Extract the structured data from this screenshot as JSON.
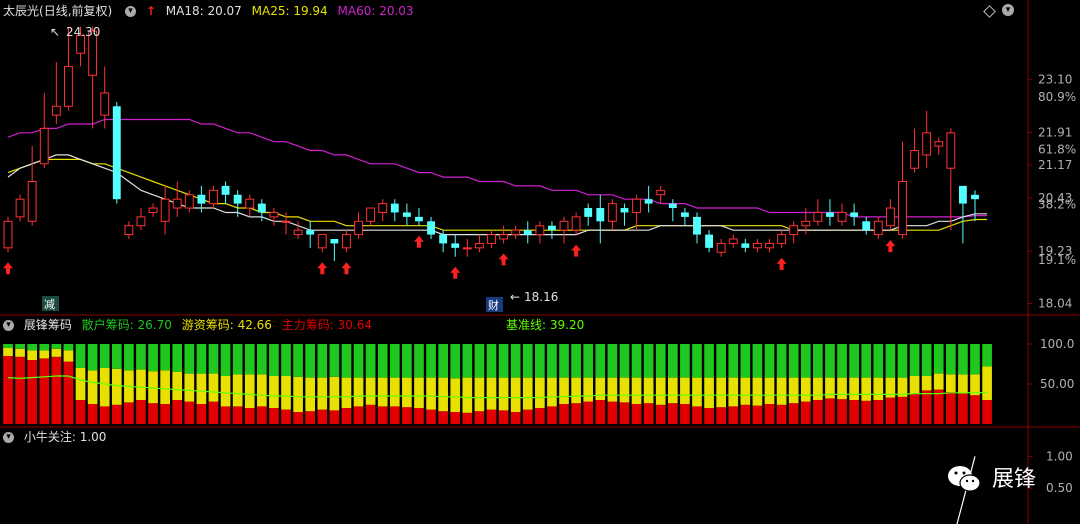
{
  "main_header": {
    "stock_name": "太辰光",
    "period": "(日线,前复权)",
    "ma18_label": "MA18: 20.07",
    "ma25_label": "MA25: 19.94",
    "ma60_label": "MA60: 20.03",
    "colors": {
      "ma18": "#e0e0e0",
      "ma25": "#e8e000",
      "ma60": "#d020d0"
    }
  },
  "chip_header": {
    "indicator_name": "展锋筹码",
    "retail_label": "散户筹码: 26.70",
    "hot_money_label": "游资筹码: 42.66",
    "main_force_label": "主力筹码: 30.64",
    "baseline_label": "基准线: 39.20",
    "colors": {
      "retail": "#1ec81e",
      "hot_money": "#e8e000",
      "main_force": "#e00000",
      "baseline": "#60ff00"
    }
  },
  "bull_header": {
    "indicator_name": "小牛关注",
    "value_label": ": 1.00"
  },
  "annotations": {
    "high_label": "24.30",
    "low_label": "18.16",
    "event_label_1": "减",
    "event_label_2": "财"
  },
  "watermark": {
    "text": "展锋"
  },
  "chart_data": {
    "type": "candlestick",
    "price_axis": {
      "ticks": [
        "23.10",
        "21.91",
        "21.17",
        "20.43",
        "19.23",
        "18.04"
      ],
      "tick_values": [
        23.1,
        21.91,
        21.17,
        20.43,
        19.23,
        18.04
      ],
      "pct_ticks": [
        "80.9%",
        "61.8%",
        "38.2%",
        "19.1%"
      ],
      "pct_tick_values": [
        22.71,
        21.52,
        20.28,
        19.03
      ],
      "ylim": [
        17.85,
        24.45
      ]
    },
    "candles": [
      [
        19.3,
        19.9,
        20.0,
        19.2
      ],
      [
        20.0,
        20.4,
        20.5,
        19.9
      ],
      [
        19.9,
        20.8,
        21.6,
        19.8
      ],
      [
        21.2,
        22.0,
        22.8,
        21.1
      ],
      [
        22.3,
        22.5,
        23.5,
        22.1
      ],
      [
        22.5,
        23.4,
        24.3,
        22.4
      ],
      [
        23.7,
        24.1,
        24.3,
        23.4
      ],
      [
        23.2,
        24.2,
        24.3,
        22.0
      ],
      [
        22.3,
        22.8,
        23.4,
        22.0
      ],
      [
        22.5,
        20.4,
        22.6,
        20.3
      ],
      [
        19.6,
        19.8,
        19.9,
        19.5
      ],
      [
        19.8,
        20.0,
        20.2,
        19.7
      ],
      [
        20.1,
        20.2,
        20.3,
        20.0
      ],
      [
        19.9,
        20.4,
        20.7,
        19.6
      ],
      [
        20.2,
        20.4,
        20.8,
        20.0
      ],
      [
        20.2,
        20.5,
        20.6,
        20.1
      ],
      [
        20.5,
        20.3,
        20.7,
        20.1
      ],
      [
        20.3,
        20.6,
        20.7,
        20.2
      ],
      [
        20.7,
        20.5,
        20.8,
        20.3
      ],
      [
        20.5,
        20.3,
        20.6,
        20.0
      ],
      [
        20.2,
        20.4,
        20.5,
        20.0
      ],
      [
        20.3,
        20.1,
        20.4,
        19.9
      ],
      [
        20.0,
        20.1,
        20.2,
        19.8
      ],
      [
        19.9,
        19.9,
        20.1,
        19.6
      ],
      [
        19.6,
        19.7,
        19.9,
        19.5
      ],
      [
        19.7,
        19.6,
        19.9,
        19.3
      ],
      [
        19.3,
        19.6,
        19.6,
        19.2
      ],
      [
        19.5,
        19.4,
        19.5,
        19.0
      ],
      [
        19.3,
        19.6,
        19.7,
        19.2
      ],
      [
        19.6,
        19.9,
        20.1,
        19.5
      ],
      [
        19.9,
        20.2,
        20.2,
        19.8
      ],
      [
        20.1,
        20.3,
        20.4,
        19.9
      ],
      [
        20.3,
        20.1,
        20.4,
        19.9
      ],
      [
        20.1,
        20.0,
        20.3,
        19.8
      ],
      [
        20.0,
        19.9,
        20.2,
        19.8
      ],
      [
        19.9,
        19.6,
        20.0,
        19.5
      ],
      [
        19.6,
        19.4,
        19.7,
        19.2
      ],
      [
        19.4,
        19.3,
        19.6,
        19.1
      ],
      [
        19.3,
        19.3,
        19.5,
        19.1
      ],
      [
        19.3,
        19.4,
        19.6,
        19.2
      ],
      [
        19.4,
        19.6,
        19.7,
        19.3
      ],
      [
        19.5,
        19.6,
        19.8,
        19.4
      ],
      [
        19.6,
        19.7,
        19.8,
        19.5
      ],
      [
        19.7,
        19.6,
        19.9,
        19.4
      ],
      [
        19.6,
        19.8,
        19.9,
        19.4
      ],
      [
        19.8,
        19.7,
        19.9,
        19.5
      ],
      [
        19.7,
        19.9,
        20.0,
        19.4
      ],
      [
        19.7,
        20.0,
        20.1,
        19.6
      ],
      [
        20.2,
        20.0,
        20.3,
        19.8
      ],
      [
        20.2,
        19.9,
        20.5,
        19.4
      ],
      [
        19.9,
        20.3,
        20.4,
        19.7
      ],
      [
        20.2,
        20.1,
        20.3,
        19.8
      ],
      [
        20.1,
        20.4,
        20.5,
        19.7
      ],
      [
        20.4,
        20.3,
        20.7,
        20.1
      ],
      [
        20.5,
        20.6,
        20.7,
        20.3
      ],
      [
        20.3,
        20.2,
        20.4,
        19.9
      ],
      [
        20.1,
        20.0,
        20.2,
        19.8
      ],
      [
        20.0,
        19.6,
        20.1,
        19.4
      ],
      [
        19.6,
        19.3,
        19.7,
        19.2
      ],
      [
        19.2,
        19.4,
        19.5,
        19.1
      ],
      [
        19.4,
        19.5,
        19.6,
        19.3
      ],
      [
        19.4,
        19.3,
        19.5,
        19.2
      ],
      [
        19.3,
        19.4,
        19.5,
        19.2
      ],
      [
        19.3,
        19.4,
        19.5,
        19.2
      ],
      [
        19.4,
        19.6,
        19.7,
        19.3
      ],
      [
        19.6,
        19.8,
        19.9,
        19.4
      ],
      [
        19.8,
        19.9,
        20.2,
        19.6
      ],
      [
        19.9,
        20.1,
        20.4,
        19.8
      ],
      [
        20.1,
        20.0,
        20.4,
        19.8
      ],
      [
        19.9,
        20.1,
        20.3,
        19.8
      ],
      [
        20.1,
        20.0,
        20.3,
        19.8
      ],
      [
        19.9,
        19.7,
        20.0,
        19.6
      ],
      [
        19.6,
        19.9,
        20.0,
        19.5
      ],
      [
        19.8,
        20.2,
        20.4,
        19.7
      ],
      [
        19.6,
        20.8,
        21.7,
        19.5
      ],
      [
        21.1,
        21.5,
        22.0,
        21.0
      ],
      [
        21.4,
        21.9,
        22.4,
        21.1
      ],
      [
        21.6,
        21.7,
        21.8,
        21.4
      ],
      [
        21.1,
        21.9,
        22.0,
        19.7
      ],
      [
        20.7,
        20.3,
        20.7,
        19.4
      ],
      [
        20.5,
        20.4,
        20.6,
        19.9
      ]
    ],
    "ma18": [
      20.9,
      21.1,
      21.2,
      21.3,
      21.4,
      21.4,
      21.3,
      21.2,
      21.1,
      21.0,
      20.8,
      20.6,
      20.5,
      20.4,
      20.3,
      20.2,
      20.2,
      20.2,
      20.1,
      20.1,
      20.0,
      20.0,
      19.9,
      19.9,
      19.8,
      19.7,
      19.7,
      19.7,
      19.7,
      19.7,
      19.7,
      19.7,
      19.7,
      19.7,
      19.7,
      19.7,
      19.6,
      19.6,
      19.6,
      19.6,
      19.6,
      19.6,
      19.6,
      19.6,
      19.6,
      19.6,
      19.6,
      19.6,
      19.7,
      19.7,
      19.7,
      19.7,
      19.7,
      19.7,
      19.8,
      19.8,
      19.8,
      19.8,
      19.8,
      19.8,
      19.7,
      19.7,
      19.7,
      19.7,
      19.7,
      19.7,
      19.7,
      19.7,
      19.7,
      19.7,
      19.7,
      19.7,
      19.7,
      19.7,
      19.8,
      19.8,
      19.8,
      19.9,
      19.9,
      20.0,
      20.07,
      20.07
    ],
    "ma25": [
      21.0,
      21.1,
      21.2,
      21.3,
      21.3,
      21.3,
      21.3,
      21.2,
      21.2,
      21.1,
      21.0,
      20.9,
      20.8,
      20.7,
      20.6,
      20.5,
      20.4,
      20.3,
      20.3,
      20.2,
      20.2,
      20.1,
      20.1,
      20.0,
      20.0,
      19.9,
      19.9,
      19.9,
      19.8,
      19.8,
      19.8,
      19.8,
      19.8,
      19.8,
      19.8,
      19.8,
      19.7,
      19.7,
      19.7,
      19.7,
      19.7,
      19.7,
      19.7,
      19.7,
      19.7,
      19.7,
      19.7,
      19.7,
      19.7,
      19.7,
      19.7,
      19.7,
      19.8,
      19.8,
      19.8,
      19.8,
      19.8,
      19.8,
      19.8,
      19.8,
      19.8,
      19.8,
      19.8,
      19.8,
      19.8,
      19.7,
      19.7,
      19.7,
      19.7,
      19.7,
      19.7,
      19.7,
      19.7,
      19.7,
      19.7,
      19.7,
      19.7,
      19.7,
      19.8,
      19.9,
      19.94,
      19.94
    ],
    "ma60": [
      21.8,
      21.9,
      21.9,
      22.0,
      22.0,
      22.1,
      22.1,
      22.1,
      22.2,
      22.2,
      22.2,
      22.2,
      22.2,
      22.2,
      22.2,
      22.2,
      22.1,
      22.1,
      22.0,
      21.9,
      21.9,
      21.8,
      21.7,
      21.7,
      21.6,
      21.5,
      21.5,
      21.4,
      21.4,
      21.3,
      21.2,
      21.2,
      21.2,
      21.1,
      21.0,
      21.0,
      20.9,
      20.9,
      20.9,
      20.8,
      20.8,
      20.8,
      20.7,
      20.7,
      20.7,
      20.6,
      20.6,
      20.6,
      20.5,
      20.5,
      20.5,
      20.4,
      20.4,
      20.4,
      20.3,
      20.3,
      20.3,
      20.2,
      20.2,
      20.2,
      20.2,
      20.2,
      20.2,
      20.1,
      20.1,
      20.1,
      20.1,
      20.1,
      20.1,
      20.1,
      20.0,
      20.0,
      20.0,
      20.0,
      20.0,
      20.0,
      20.0,
      20.0,
      20.0,
      20.0,
      20.03,
      20.03
    ],
    "buy_signal_indices": [
      0,
      26,
      28,
      34,
      37,
      41,
      47,
      64,
      73
    ],
    "chip_axis": {
      "ticks": [
        "100.0",
        "50.00"
      ],
      "tick_values": [
        100,
        50
      ],
      "ylim": [
        0,
        110
      ]
    },
    "chips": {
      "main_force": [
        85,
        84,
        80,
        82,
        84,
        78,
        30,
        25,
        22,
        24,
        27,
        30,
        26,
        25,
        30,
        28,
        25,
        28,
        22,
        22,
        20,
        22,
        20,
        18,
        15,
        16,
        18,
        17,
        20,
        22,
        24,
        22,
        22,
        21,
        20,
        18,
        16,
        15,
        14,
        16,
        18,
        17,
        15,
        18,
        20,
        22,
        25,
        26,
        28,
        30,
        28,
        27,
        25,
        26,
        24,
        26,
        25,
        22,
        20,
        21,
        22,
        24,
        23,
        25,
        24,
        26,
        28,
        30,
        32,
        31,
        30,
        29,
        30,
        33,
        34,
        38,
        42,
        43,
        40,
        38,
        36,
        30
      ],
      "hot_money": [
        10,
        10,
        12,
        10,
        10,
        14,
        40,
        42,
        48,
        45,
        40,
        38,
        40,
        42,
        35,
        35,
        38,
        35,
        38,
        40,
        42,
        40,
        40,
        42,
        44,
        42,
        40,
        42,
        38,
        36,
        34,
        36,
        36,
        37,
        38,
        40,
        42,
        42,
        44,
        42,
        40,
        41,
        43,
        40,
        38,
        36,
        33,
        32,
        30,
        28,
        30,
        31,
        33,
        32,
        34,
        32,
        33,
        36,
        38,
        37,
        36,
        34,
        35,
        33,
        34,
        32,
        30,
        28,
        26,
        27,
        28,
        29,
        28,
        25,
        24,
        22,
        18,
        20,
        22,
        24,
        26,
        42
      ],
      "baseline": [
        58,
        57,
        58,
        59,
        60,
        60,
        55,
        52,
        50,
        48,
        47,
        46,
        45,
        44,
        43,
        42,
        41,
        40,
        39,
        38,
        37,
        36,
        35,
        35,
        34,
        34,
        34,
        34,
        34,
        35,
        35,
        35,
        35,
        35,
        35,
        35,
        34,
        34,
        33,
        33,
        33,
        33,
        33,
        33,
        33,
        34,
        34,
        35,
        35,
        36,
        36,
        36,
        36,
        36,
        36,
        36,
        36,
        36,
        36,
        36,
        36,
        36,
        36,
        36,
        36,
        36,
        36,
        36,
        37,
        37,
        37,
        37,
        37,
        37,
        37,
        38,
        38,
        38,
        39,
        39,
        39.2,
        39.2
      ]
    },
    "bull_axis": {
      "ticks": [
        "1.00",
        "0.50"
      ],
      "tick_values": [
        1.0,
        0.5
      ],
      "ylim": [
        0,
        1.1
      ]
    },
    "bull_values_last": 1.0
  }
}
